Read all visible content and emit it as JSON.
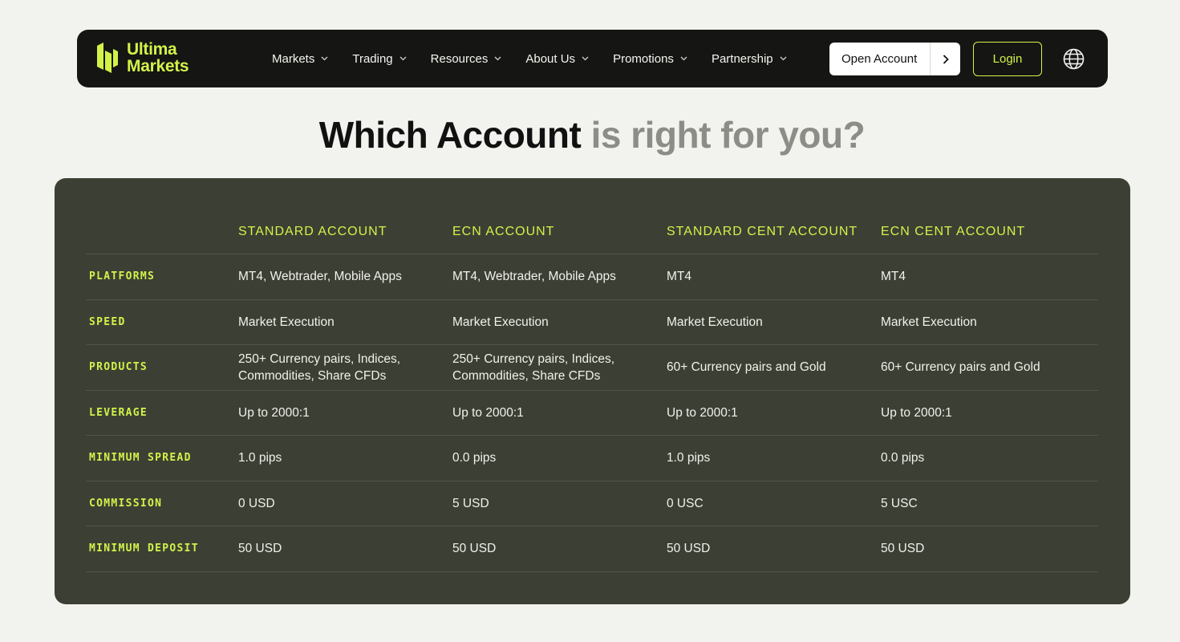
{
  "brand": {
    "line1": "Ultima",
    "line2": "Markets",
    "accent": "#d2f24a",
    "nav_bg": "#151613",
    "panel_bg": "#3c4034"
  },
  "nav": {
    "items": [
      {
        "label": "Markets",
        "icon": "chevron-down-icon"
      },
      {
        "label": "Trading",
        "icon": "chevron-down-icon"
      },
      {
        "label": "Resources",
        "icon": "chevron-down-icon"
      },
      {
        "label": "About Us",
        "icon": "chevron-down-icon"
      },
      {
        "label": "Promotions",
        "icon": "chevron-down-icon"
      },
      {
        "label": "Partnership",
        "icon": "chevron-down-icon"
      }
    ],
    "open_account": "Open Account",
    "login": "Login",
    "language_icon": "globe-icon"
  },
  "headline": {
    "strong": "Which Account",
    "muted": "is right for you?"
  },
  "table": {
    "columns": [
      "STANDARD ACCOUNT",
      "ECN ACCOUNT",
      "STANDARD CENT ACCOUNT",
      "ECN CENT ACCOUNT"
    ],
    "rows": [
      {
        "label": "PLATFORMS",
        "values": [
          "MT4, Webtrader, Mobile Apps",
          "MT4, Webtrader, Mobile Apps",
          "MT4",
          "MT4"
        ]
      },
      {
        "label": "SPEED",
        "values": [
          "Market Execution",
          "Market Execution",
          "Market Execution",
          "Market Execution"
        ]
      },
      {
        "label": "PRODUCTS",
        "values": [
          "250+ Currency pairs, Indices, Commodities, Share CFDs",
          "250+ Currency pairs, Indices, Commodities, Share CFDs",
          "60+ Currency pairs and Gold",
          "60+ Currency pairs and Gold"
        ]
      },
      {
        "label": "LEVERAGE",
        "values": [
          "Up to 2000:1",
          "Up to 2000:1",
          "Up to 2000:1",
          "Up to 2000:1"
        ]
      },
      {
        "label": "MINIMUM SPREAD",
        "values": [
          "1.0 pips",
          "0.0 pips",
          "1.0 pips",
          "0.0 pips"
        ]
      },
      {
        "label": "COMMISSION",
        "values": [
          "0 USD",
          "5 USD",
          "0 USC",
          "5 USC"
        ]
      },
      {
        "label": "MINIMUM DEPOSIT",
        "values": [
          "50 USD",
          "50 USD",
          "50 USD",
          "50 USD"
        ]
      }
    ]
  }
}
